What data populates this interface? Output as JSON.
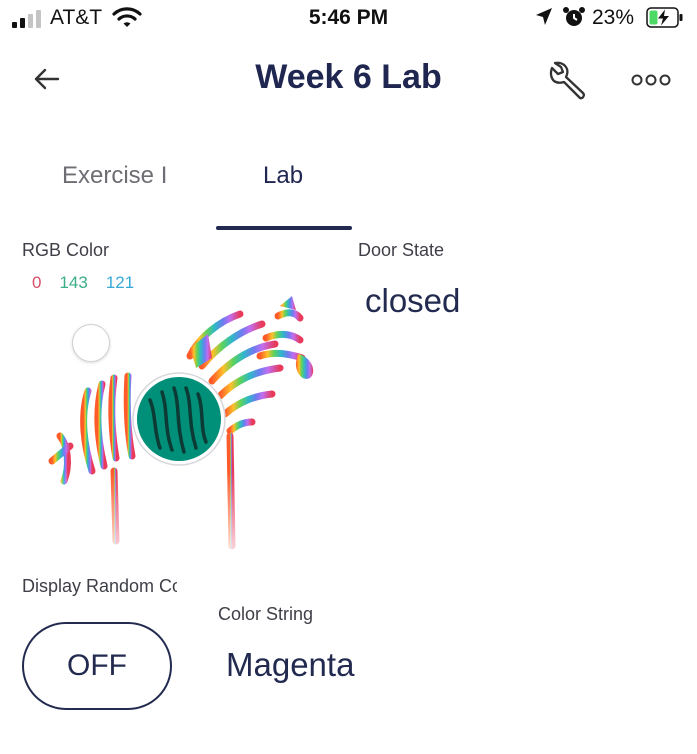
{
  "status_bar": {
    "carrier": "AT&T",
    "time": "5:46 PM",
    "battery_percent": "23%",
    "signal_bars_active": 2,
    "signal_bars_total": 4
  },
  "header": {
    "title": "Week 6 Lab",
    "back_icon": "arrow-left-icon",
    "settings_icon": "wrench-icon",
    "more_icon": "more-horizontal-icon"
  },
  "tabs": [
    {
      "label": "Exercise I",
      "active": false
    },
    {
      "label": "Lab",
      "active": true
    }
  ],
  "rgb_widget": {
    "label": "RGB Color",
    "r": "0",
    "g": "143",
    "b": "121",
    "selected_color": "#008f79"
  },
  "door_widget": {
    "label": "Door State",
    "value": "closed"
  },
  "random_widget": {
    "label": "Display Random Color",
    "toggle_value": "OFF"
  },
  "color_string_widget": {
    "label": "Color String",
    "value": "Magenta"
  },
  "colors": {
    "accent": "#222a4f",
    "text_muted": "#6d6d74",
    "battery_green": "#4cd964"
  }
}
